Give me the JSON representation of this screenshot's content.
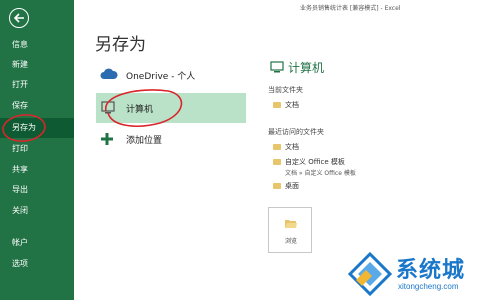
{
  "window": {
    "title": "业务员销售统计表 [兼容模式] - Excel"
  },
  "sidebar": {
    "back_icon": "back-arrow-icon",
    "items": [
      {
        "label": "信息"
      },
      {
        "label": "新建"
      },
      {
        "label": "打开"
      },
      {
        "label": "保存"
      },
      {
        "label": "另存为",
        "active": true
      },
      {
        "label": "打印"
      },
      {
        "label": "共享"
      },
      {
        "label": "导出"
      },
      {
        "label": "关闭"
      },
      {
        "label": "帐户"
      },
      {
        "label": "选项"
      }
    ]
  },
  "page": {
    "title": "另存为"
  },
  "locations": [
    {
      "label": "OneDrive - 个人",
      "icon": "cloud-icon"
    },
    {
      "label": "计算机",
      "icon": "computer-icon",
      "selected": true
    },
    {
      "label": "添加位置",
      "icon": "plus-icon"
    }
  ],
  "right_panel": {
    "title": "计算机",
    "current_folder_label": "当前文件夹",
    "current_folder": "文档",
    "recent_label": "最近访问的文件夹",
    "recent": [
      {
        "name": "文档",
        "path": ""
      },
      {
        "name": "自定义 Office 模板",
        "path": "文档 » 自定义 Office 模板"
      },
      {
        "name": "桌面",
        "path": ""
      }
    ],
    "browse_label": "浏览"
  },
  "watermark": {
    "text": "系统城",
    "url": "xitongcheng.com"
  },
  "colors": {
    "accent": "#217346",
    "selected": "#b9e2c8",
    "annotation": "#d9262c"
  }
}
